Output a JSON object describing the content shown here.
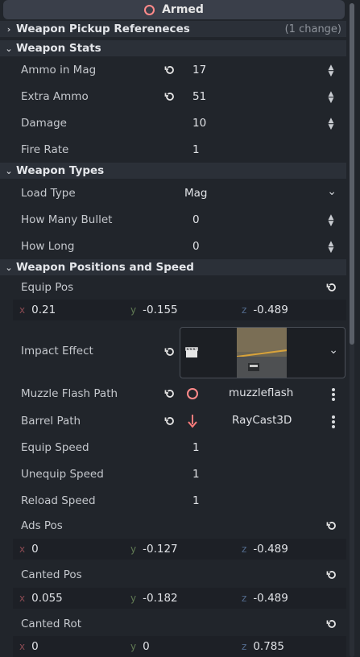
{
  "header": {
    "title": "Armed"
  },
  "sections": {
    "pickup": {
      "title": "Weapon Pickup Refereneces",
      "note": "(1 change)"
    },
    "stats": {
      "title": "Weapon Stats"
    },
    "types": {
      "title": "Weapon Types"
    },
    "positions": {
      "title": "Weapon Positions and Speed"
    }
  },
  "stats": {
    "ammo_in_mag": {
      "label": "Ammo in Mag",
      "value": "17"
    },
    "extra_ammo": {
      "label": "Extra Ammo",
      "value": "51"
    },
    "damage": {
      "label": "Damage",
      "value": "10"
    },
    "fire_rate": {
      "label": "Fire Rate",
      "value": "1"
    }
  },
  "types": {
    "load_type": {
      "label": "Load Type",
      "value": "Mag"
    },
    "how_many_bullet": {
      "label": "How Many Bullet",
      "value": "0"
    },
    "how_long": {
      "label": "How Long",
      "value": "0"
    }
  },
  "positions": {
    "equip_pos": {
      "label": "Equip Pos",
      "x": "0.21",
      "y": "-0.155",
      "z": "-0.489"
    },
    "impact_effect": {
      "label": "Impact Effect"
    },
    "muzzle_flash_path": {
      "label": "Muzzle Flash Path",
      "value": "muzzleflash"
    },
    "barrel_path": {
      "label": "Barrel Path",
      "value": "RayCast3D"
    },
    "equip_speed": {
      "label": "Equip Speed",
      "value": "1"
    },
    "unequip_speed": {
      "label": "Unequip Speed",
      "value": "1"
    },
    "reload_speed": {
      "label": "Reload Speed",
      "value": "1"
    },
    "ads_pos": {
      "label": "Ads Pos",
      "x": "0",
      "y": "-0.127",
      "z": "-0.489"
    },
    "canted_pos": {
      "label": "Canted Pos",
      "x": "0.055",
      "y": "-0.182",
      "z": "-0.489"
    },
    "canted_rot": {
      "label": "Canted Rot",
      "x": "0",
      "y": "0",
      "z": "0.785"
    }
  },
  "axes": {
    "x": "x",
    "y": "y",
    "z": "z"
  },
  "colors": {
    "accent_red": "#ff8a8a",
    "bg": "#21252b",
    "section_bg": "#2b3038"
  }
}
